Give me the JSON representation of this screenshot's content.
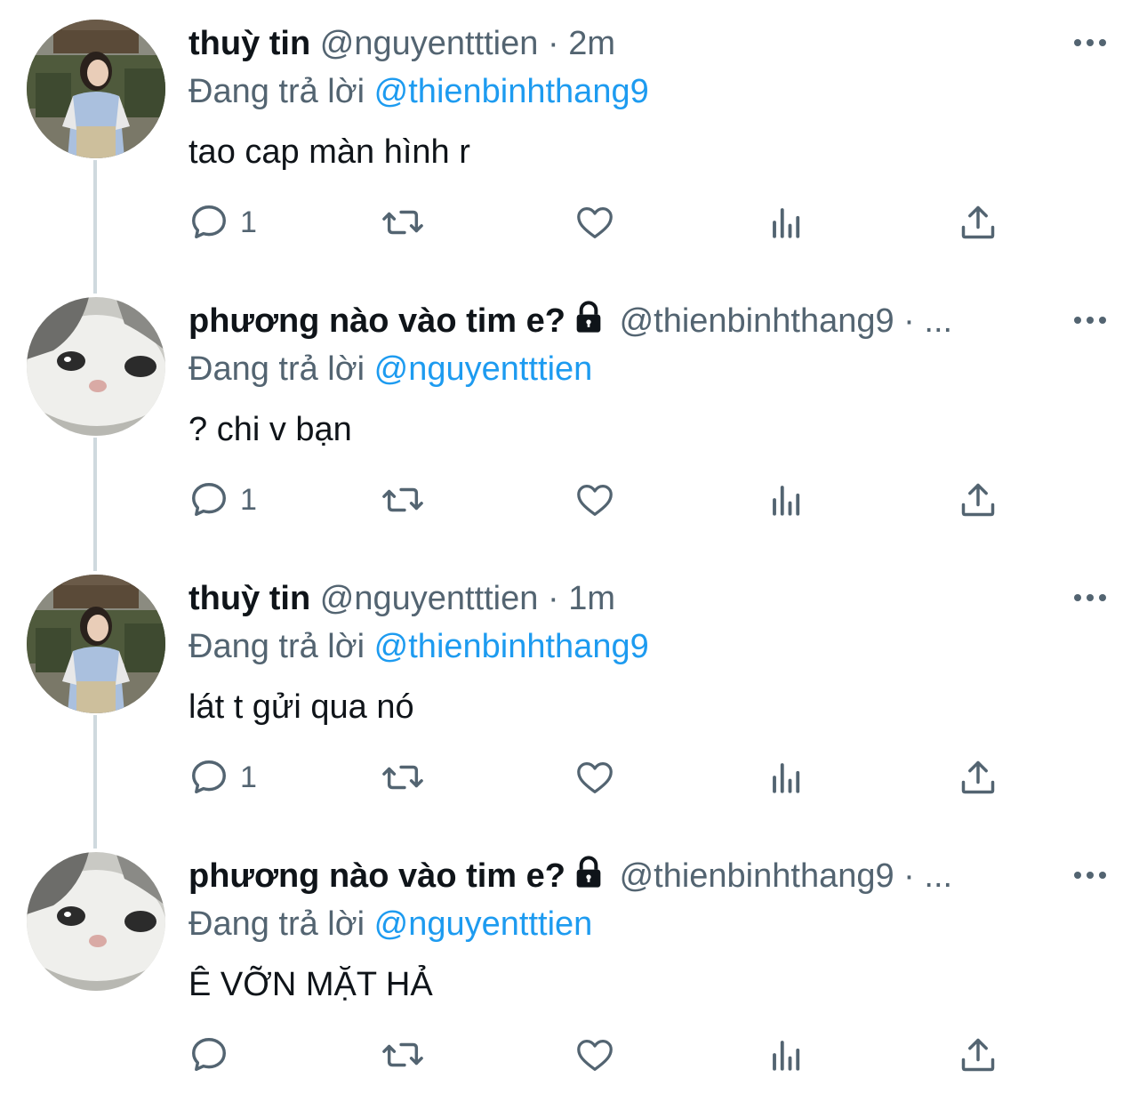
{
  "tweets": [
    {
      "name": "thuỳ tin",
      "handle": "@nguyentttien",
      "separator": "·",
      "time": "2m",
      "replying_prefix": "Đang trả lời",
      "replying_to": "@thienbinhthang9",
      "text": "tao cap màn hình r",
      "reply_count": "1",
      "avatar": "girl-photo",
      "locked": false
    },
    {
      "name": "phương nào vào tim e?",
      "handle": "@thienbinhthang9",
      "separator": "·",
      "time": "...",
      "replying_prefix": "Đang trả lời",
      "replying_to": "@nguyentttien",
      "text": "? chi v bạn",
      "reply_count": "1",
      "avatar": "cat-photo",
      "locked": true
    },
    {
      "name": "thuỳ tin",
      "handle": "@nguyentttien",
      "separator": "·",
      "time": "1m",
      "replying_prefix": "Đang trả lời",
      "replying_to": "@thienbinhthang9",
      "text": "lát t gửi qua nó",
      "reply_count": "1",
      "avatar": "girl-photo",
      "locked": false
    },
    {
      "name": "phương nào vào tim e?",
      "handle": "@thienbinhthang9",
      "separator": "·",
      "time": "...",
      "replying_prefix": "Đang trả lời",
      "replying_to": "@nguyentttien",
      "text": "Ê VỠN MẶT HẢ",
      "reply_count": "",
      "avatar": "cat-photo",
      "locked": true
    }
  ],
  "colors": {
    "text": "#0f1419",
    "secondary": "#536471",
    "mention": "#1d9bf0",
    "thread_line": "#cfd9de"
  },
  "icons": [
    "reply-icon",
    "retweet-icon",
    "like-icon",
    "analytics-icon",
    "share-icon",
    "more-icon",
    "lock-icon"
  ]
}
